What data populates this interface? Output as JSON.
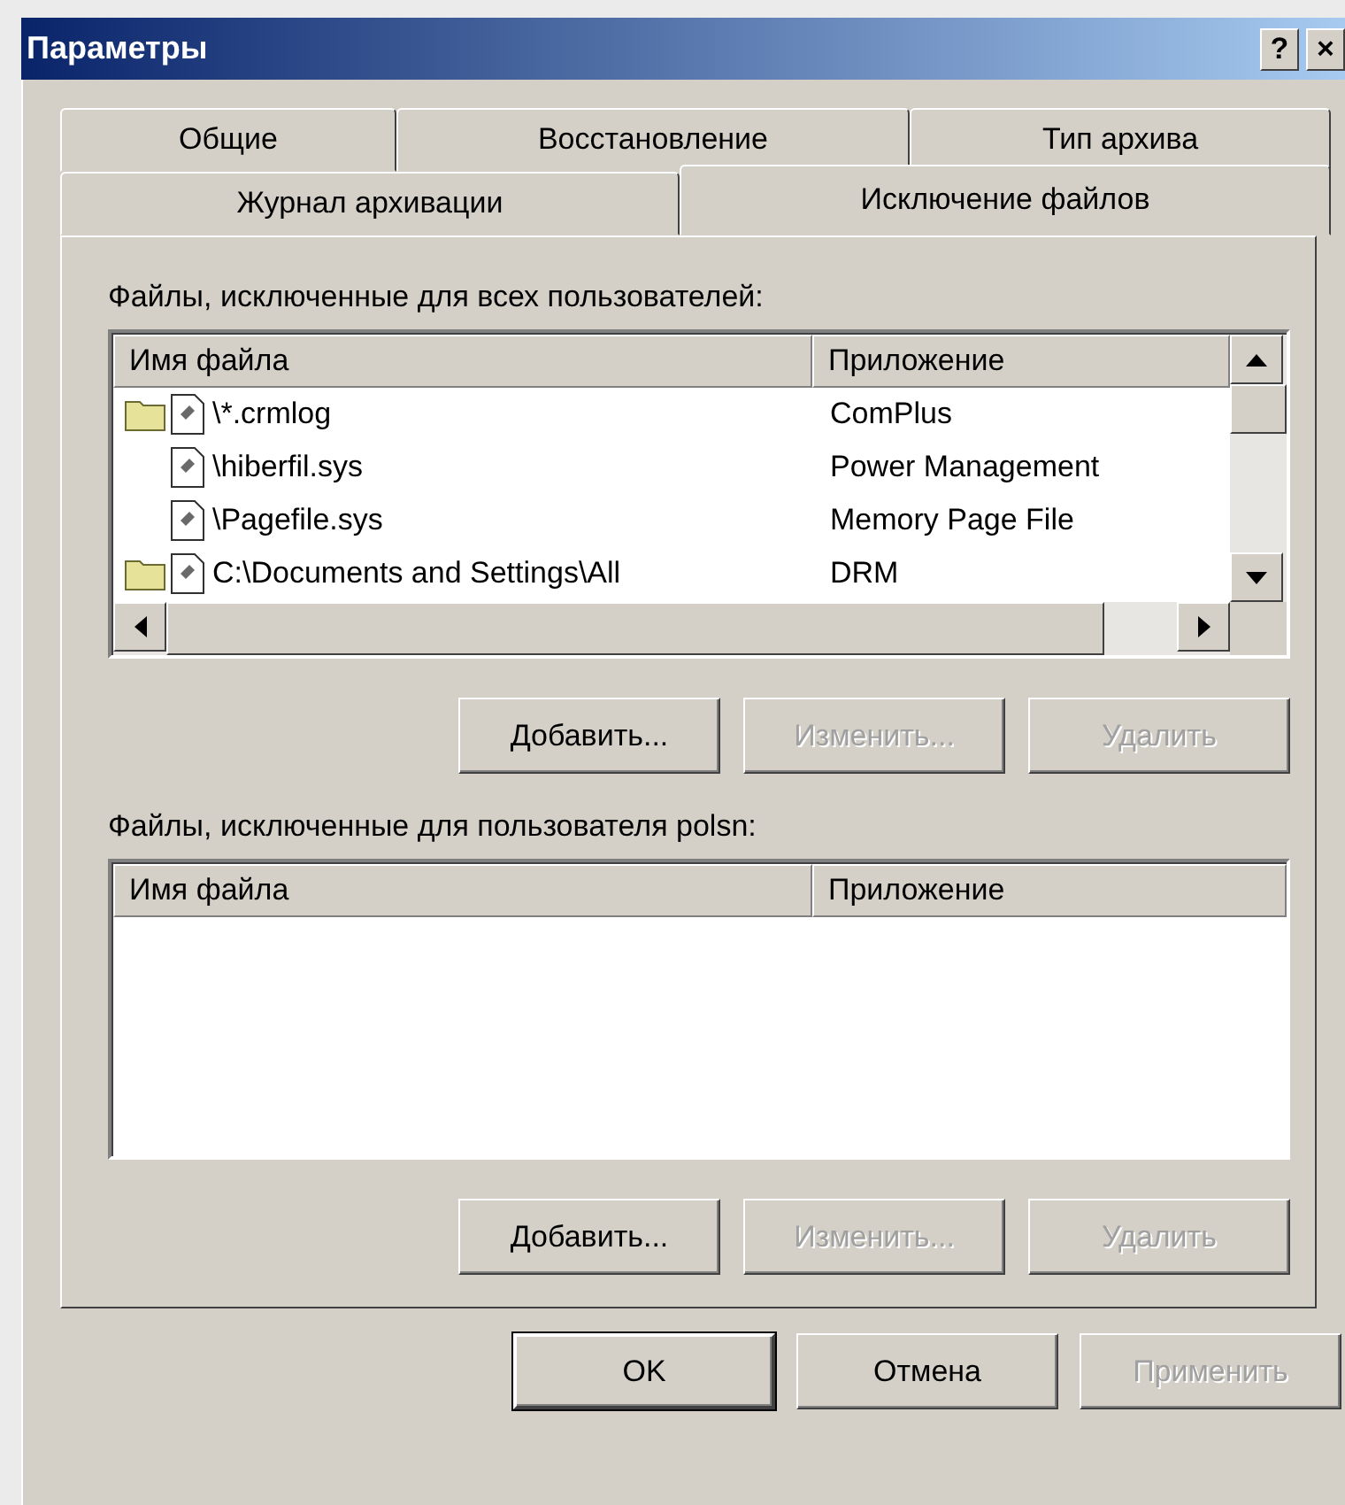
{
  "window": {
    "title": "Параметры",
    "help": "?",
    "close": "×"
  },
  "tabs": [
    [
      {
        "label": "Общие",
        "selected": false
      },
      {
        "label": "Восстановление",
        "selected": false
      },
      {
        "label": "Тип архива",
        "selected": false
      }
    ],
    [
      {
        "label": "Журнал архивации",
        "selected": false
      },
      {
        "label": "Исключение файлов",
        "selected": true
      }
    ]
  ],
  "all_users": {
    "label": "Файлы, исключенные для всех пользователей:",
    "columns": [
      "Имя файла",
      "Приложение"
    ],
    "rows": [
      {
        "kind": "folder",
        "file": "\\*.crmlog",
        "application": "ComPlus"
      },
      {
        "kind": "file",
        "file": "\\hiberfil.sys",
        "application": "Power Management"
      },
      {
        "kind": "file",
        "file": "\\Pagefile.sys",
        "application": "Memory Page File"
      },
      {
        "kind": "folder",
        "file": "C:\\Documents and Settings\\All",
        "application": "DRM"
      }
    ],
    "buttons": [
      {
        "label": "Добавить...",
        "disabled": false
      },
      {
        "label": "Изменить...",
        "disabled": true
      },
      {
        "label": "Удалить",
        "disabled": true
      }
    ]
  },
  "user": {
    "label": "Файлы, исключенные для пользователя polsn:",
    "columns": [
      "Имя файла",
      "Приложение"
    ],
    "buttons": [
      {
        "label": "Добавить...",
        "disabled": false
      },
      {
        "label": "Изменить...",
        "disabled": true
      },
      {
        "label": "Удалить",
        "disabled": true
      }
    ]
  },
  "dialog_buttons": [
    {
      "label": "OK",
      "disabled": false,
      "default": true
    },
    {
      "label": "Отмена",
      "disabled": false,
      "default": false
    },
    {
      "label": "Применить",
      "disabled": true,
      "default": false
    }
  ]
}
